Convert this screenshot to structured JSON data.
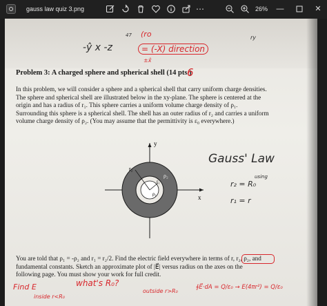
{
  "window": {
    "title": "gauss law quiz 3.png",
    "zoom_level": "26%",
    "icons": [
      "edit-icon",
      "rotate-icon",
      "delete-icon",
      "heart-icon",
      "info-icon",
      "share-icon",
      "more-icon",
      "zoom-out-icon",
      "zoom-in-icon",
      "minimize-icon",
      "maximize-icon",
      "close-icon"
    ]
  },
  "document": {
    "problem_title": "Problem 3: A charged sphere and spherical shell (14 pts.)",
    "paragraph1": [
      "In this problem, we will consider a sphere and a spherical shell that carry uniform charge densities.",
      "The sphere and spherical shell are illustrated below in the xy-plane. The sphere is centered at the",
      "origin and has a radius of r₁. This sphere carries a uniform volume charge density of ρ₁.",
      "Surrounding this sphere is a spherical shell. The shell has an outer radius of r₂ and carries a uniform",
      "volume charge density of ρ₂. (You may assume that the permittivity is ε₀ everywhere.)"
    ],
    "paragraph2": [
      "You are told that ρ₁ = -ρ₂ and r₁ = r₂/2. Find the electric field everywhere in terms of r, r₂, ρ₂, and",
      "fundamental constants. Sketch an approximate plot of |E⃗| versus radius on the axes on the",
      "following page. You must show your work for full credit."
    ],
    "diagram": {
      "y_label": "y",
      "x_label": "x",
      "r2_label": "r₂",
      "rho2_label": "ρ₂",
      "r1_label": "r₁",
      "rho1_label": "ρ₁"
    }
  },
  "handwriting": {
    "top_left": "-ŷ x -z",
    "top_mid1": "(ro",
    "top_mid2": "= (-X) direction",
    "top_mid3": "±x̂",
    "top_47": "47",
    "top_ry": "ry",
    "mark_six": "6",
    "gauss_law": "Gauss' Law",
    "r2_ro": "r₂ = R₀",
    "using": "using",
    "r1_r": "r₁ = r",
    "find_e": "Find E",
    "inside": "inside r<R₀",
    "whats_ro": "what's R₀?",
    "outside": "outside r>R₀",
    "gauss_eq": "∮E⃗·dA = Q/ε₀ → E(4πr²) = Q/ε₀"
  },
  "colors": {
    "titlebar_bg": "#202020",
    "paper": "#ece9e4",
    "ink_red": "#d8262b",
    "shell_gray": "#6a6a6a"
  }
}
